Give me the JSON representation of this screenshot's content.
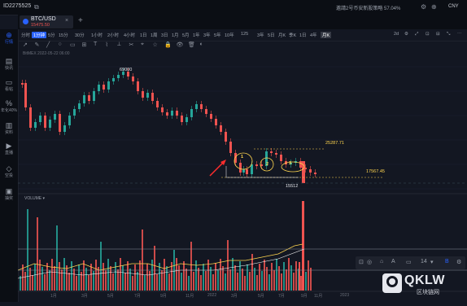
{
  "topbar": {
    "user_id": "ID2275525",
    "promo": "邀請2号币安新股策略 57.04%",
    "currency": "CNY"
  },
  "tab": {
    "symbol": "BTC/USD",
    "price": "15475.50",
    "close": "×",
    "add": "+"
  },
  "sidebar": [
    {
      "label": "行情",
      "icon": "chart-icon",
      "glyph": "⊕"
    },
    {
      "label": "快讯",
      "icon": "news-icon",
      "glyph": "▤"
    },
    {
      "label": "看帖",
      "icon": "post-icon",
      "glyph": "▭"
    },
    {
      "label": "年化40%",
      "icon": "earn-icon",
      "glyph": "%"
    },
    {
      "label": "资料",
      "icon": "data-icon",
      "glyph": "▥"
    },
    {
      "label": "直播",
      "icon": "live-icon",
      "glyph": "▶"
    },
    {
      "label": "空投",
      "icon": "airdrop-icon",
      "glyph": "◇"
    },
    {
      "label": "抽奖",
      "icon": "lottery-icon",
      "glyph": "▣"
    }
  ],
  "toolbar": {
    "items": [
      "分时",
      "1分钟",
      "5分",
      "15分",
      "30分",
      "1小时",
      "2小时",
      "4小时",
      "1日",
      "1周",
      "3日",
      "1月",
      "5月",
      "1年",
      "3年",
      "5年",
      "10年",
      "125",
      "3年",
      "5日",
      "月K",
      "季K",
      "1日",
      "4年",
      "月K"
    ],
    "selected_index": 24,
    "right": [
      "2d",
      "⚙",
      "⤢",
      "⊡",
      "⊟",
      "⤡",
      "⋯"
    ]
  },
  "draw_tools": [
    "↗",
    "✎",
    "╱",
    "○",
    "▭",
    "⊞",
    "T",
    "⌇",
    "⟂",
    "✂",
    "⌖",
    "☆",
    "🔒",
    "👁",
    "🗑",
    "◐"
  ],
  "info_line": "BitMEX 2022-05-22 06:00",
  "annotations": {
    "peak": "69000",
    "resistance": "25287.71",
    "support": "17567.45",
    "low": "15512",
    "pattern_labels": [
      "1",
      "2",
      "3"
    ]
  },
  "volume_title": "VOLUME ▾",
  "float_toolbar": [
    "⊡",
    "◎",
    "⌂",
    "A",
    "▭",
    "14",
    "▾",
    "B",
    "⚙"
  ],
  "x_axis": [
    "1月",
    "3月",
    "5月",
    "7月",
    "9月",
    "11月",
    "2022",
    "3月",
    "5月",
    "7月",
    "9月",
    "11月",
    "2023"
  ],
  "watermark": {
    "brand": "QKLW",
    "sub": "区块链网"
  },
  "colors": {
    "up": "#26a69a",
    "down": "#ef5350",
    "accent": "#2962ff",
    "annotation": "#ffd54f"
  }
}
